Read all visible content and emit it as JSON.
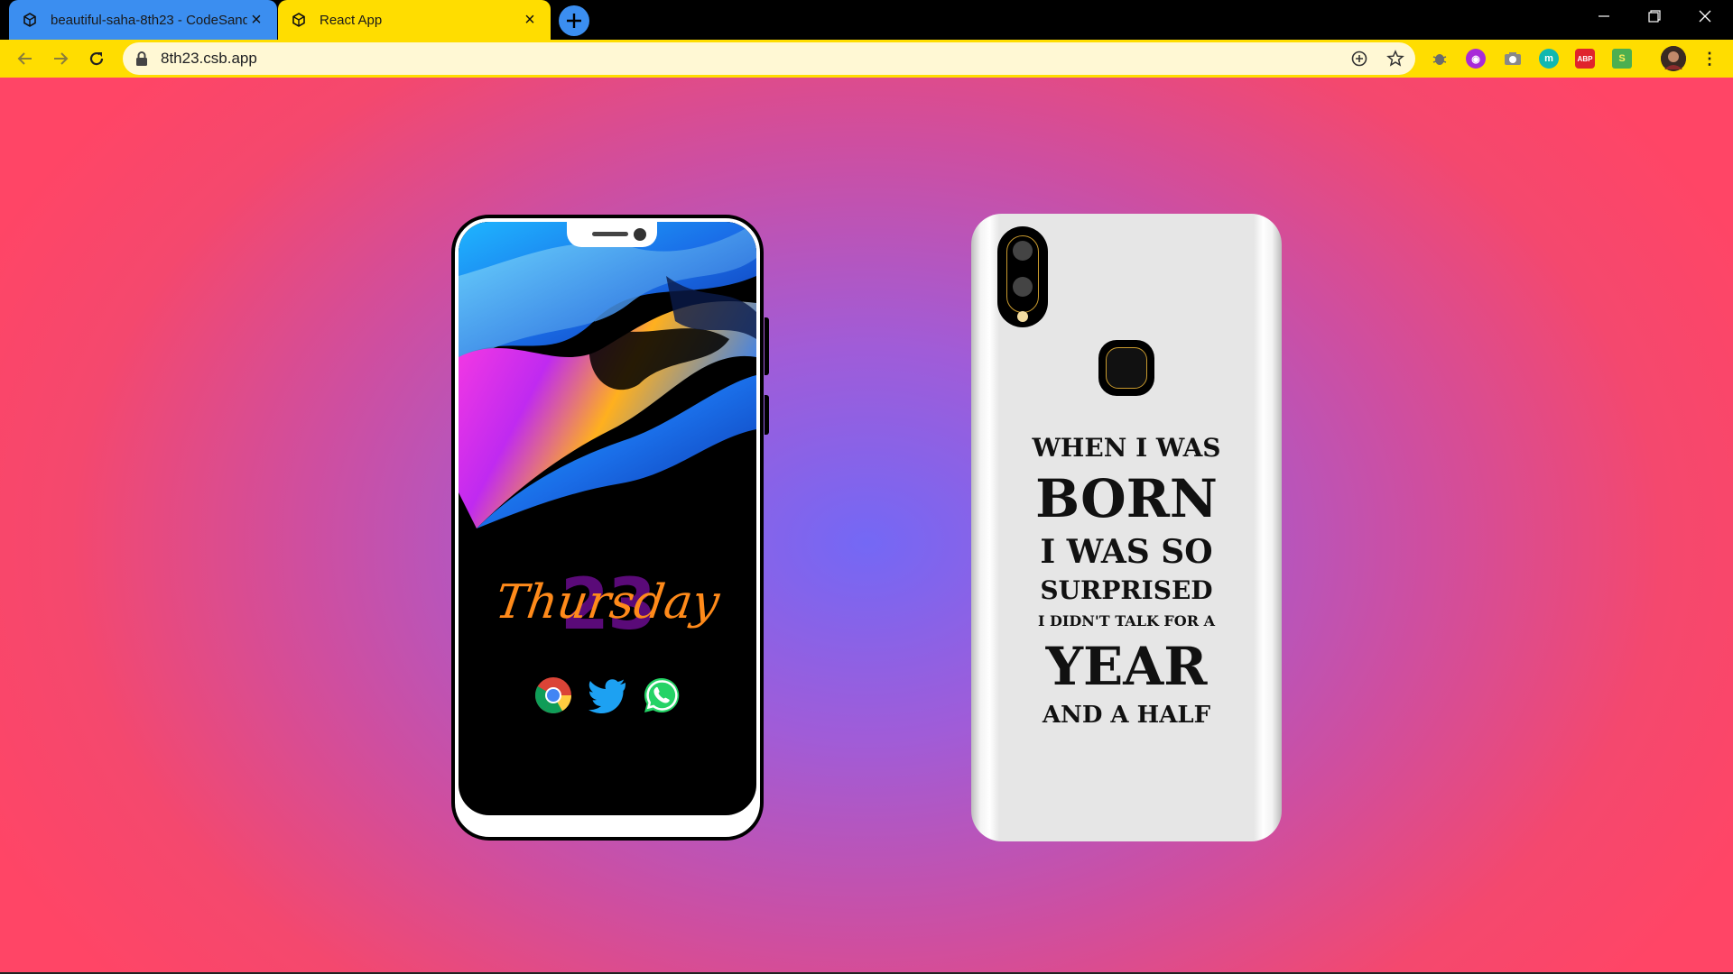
{
  "browser": {
    "tabs": [
      {
        "title": "beautiful-saha-8th23 - CodeSandbox",
        "active": false,
        "color": "#3b8ef0"
      },
      {
        "title": "React App",
        "active": true,
        "color": "#ffdd00"
      }
    ],
    "new_tab_icon": "plus-icon",
    "window_controls": [
      "minimize-icon",
      "restore-icon",
      "close-icon"
    ],
    "address_bar": {
      "url": "8th23.csb.app",
      "secure": true
    },
    "extensions": [
      "bug-icon",
      "purple-extension-icon",
      "camera-icon",
      "teal-extension-icon",
      "adblock-icon",
      "s-extension-icon"
    ],
    "profile": "avatar"
  },
  "page": {
    "background": {
      "center": "#7468f5",
      "edge": "#ff4566"
    },
    "front_phone": {
      "day_number": "23",
      "day_name": "Thursday",
      "apps": [
        "chrome-icon",
        "twitter-icon",
        "whatsapp-icon"
      ]
    },
    "back_phone": {
      "quote_lines": [
        "WHEN I WAS",
        "BORN",
        "I WAS SO",
        "SURPRISED",
        "I DIDN'T TALK FOR A",
        "YEAR",
        "AND A HALF"
      ]
    }
  }
}
